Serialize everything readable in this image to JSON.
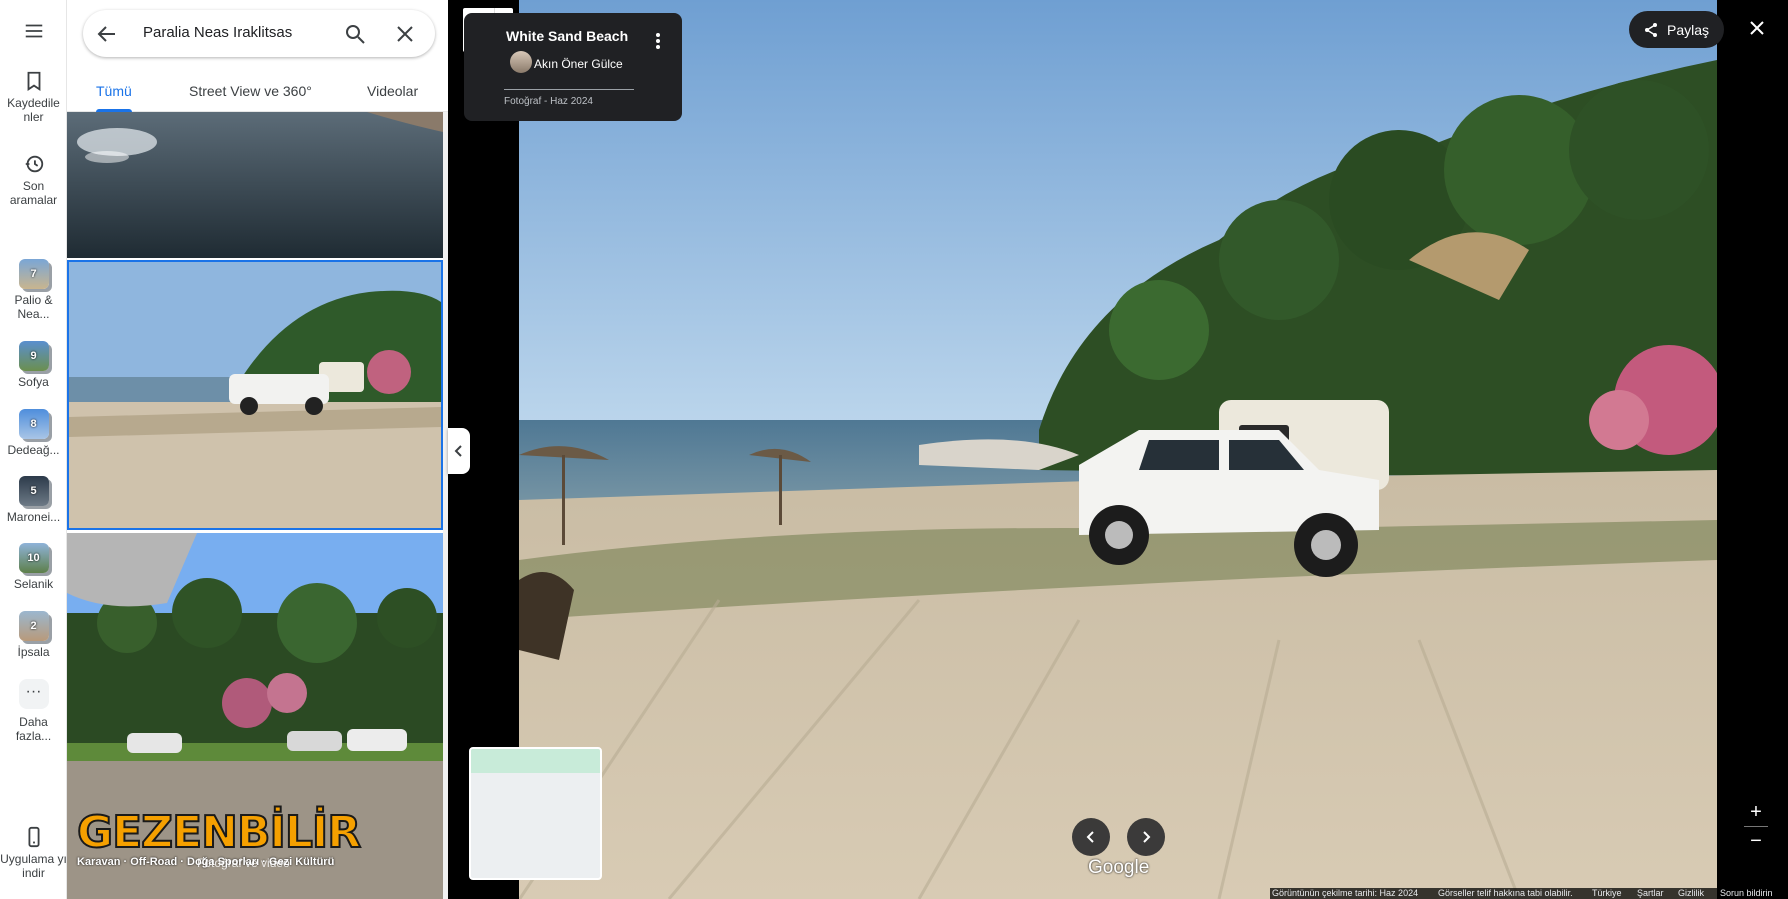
{
  "rail": {
    "saved": "Kaydedile nler",
    "recent": "Son aramalar",
    "recents": [
      {
        "label": "Palio & Nea...",
        "count": "7"
      },
      {
        "label": "Sofya",
        "count": "9"
      },
      {
        "label": "Dedeağ...",
        "count": "8"
      },
      {
        "label": "Maronei...",
        "count": "5"
      },
      {
        "label": "Selanik",
        "count": "10"
      },
      {
        "label": "İpsala",
        "count": "2"
      }
    ],
    "more": "Daha fazla...",
    "more_dots": "···",
    "app": "Uygulama yı indir"
  },
  "search": {
    "query": "Paralia Neas Iraklitsas"
  },
  "tabs": [
    "Tümü",
    "Street View ve 360°",
    "Videolar"
  ],
  "logo": {
    "name": "GEZENBİLİR",
    "tagline": "Karavan · Off-Road · Doğa Sporları · Gezi Kültürü",
    "caption": "Fotoğraf ve video"
  },
  "info": {
    "title": "White Sand Beach",
    "author": "Akın Öner Gülce",
    "meta": "Fotoğraf - Haz 2024"
  },
  "share_label": "Paylaş",
  "google_label": "Google",
  "zoom": {
    "in": "+",
    "out": "−"
  },
  "footer": {
    "date": "Görüntünün çekilme tarihi: Haz 2024",
    "copyright": "Görseller telif hakkına tabi olabilir.",
    "country": "Türkiye",
    "terms": "Şartlar",
    "privacy": "Gizlilik",
    "report": "Sorun bildirin"
  },
  "colors": {
    "accent": "#1a73e8",
    "sky": "#9cc3e6",
    "sand": "#cdbfa8"
  }
}
